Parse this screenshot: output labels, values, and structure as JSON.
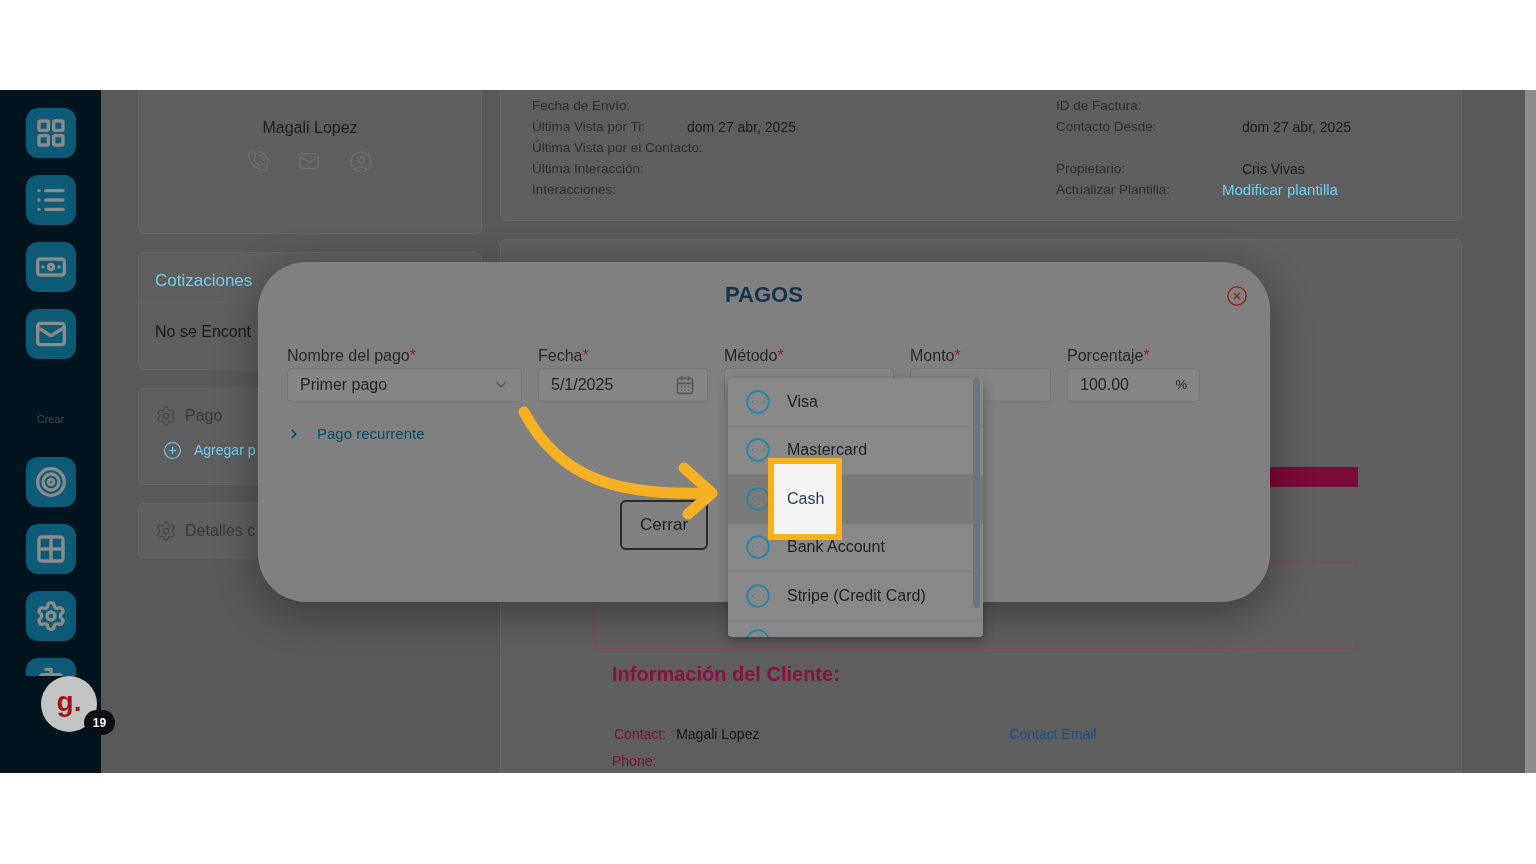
{
  "sidebar": {
    "section_label": "Crear"
  },
  "assistant_bubble": {
    "logo": "g.",
    "count": "19"
  },
  "contact_card": {
    "name": "Magali Lopez"
  },
  "details": {
    "left": [
      {
        "label": "Fecha de Envío:"
      },
      {
        "label": "Última Vista por Ti:",
        "value": "dom 27 abr, 2025"
      },
      {
        "label": "Última Vista por el Contacto:"
      },
      {
        "label": "Última Interacción:"
      },
      {
        "label": "Interacciones:"
      }
    ],
    "right": [
      {
        "label": "ID de Factura:"
      },
      {
        "label": "Contacto Desde:",
        "value": "dom 27 abr, 2025"
      },
      {
        "kind": "gap"
      },
      {
        "label": "Propietario:",
        "value": "Cris Vivas"
      },
      {
        "label": "Actualizar Plantilla:",
        "value": "Modificar plantilla",
        "kind": "link"
      }
    ]
  },
  "quotes_panel": {
    "title": "Cotizaciones",
    "empty": "No se Encont"
  },
  "payment_panel": {
    "title": "Pago",
    "action": "Agregar p"
  },
  "details_panel": {
    "title": "Detalles c"
  },
  "client_info": {
    "heading": "Información del Cliente:",
    "contact_label": "Contact:",
    "contact_value": "Magali Lopez",
    "email_link": "Contact Email",
    "phone_label": "Phone:"
  },
  "modal": {
    "title": "PAGOS",
    "fields": [
      {
        "label": "Nombre del pago",
        "required_mark": "*",
        "kind": "select",
        "value": "Primer pago"
      },
      {
        "label": "Fecha",
        "required_mark": "*",
        "kind": "date",
        "value": "5/1/2025"
      },
      {
        "label": "Método",
        "required_mark": "*",
        "kind": "dropdown"
      },
      {
        "label": "Monto",
        "required_mark": "*",
        "kind": "text"
      },
      {
        "label": "Porcentaje",
        "required_mark": "*",
        "kind": "percent",
        "value": "100.00",
        "suffix": "%"
      }
    ],
    "recurring_link": "Pago recurrente",
    "close_button": "Cerrar",
    "method_options": [
      {
        "label": "Visa",
        "selected": false,
        "spotlight": false
      },
      {
        "label": "Mastercard",
        "selected": false,
        "spotlight": false
      },
      {
        "label": "Cash",
        "selected": true,
        "spotlight": true
      },
      {
        "label": "Bank Account",
        "selected": false,
        "spotlight": false
      },
      {
        "label": "Stripe (Credit Card)",
        "selected": false,
        "spotlight": false
      }
    ]
  }
}
